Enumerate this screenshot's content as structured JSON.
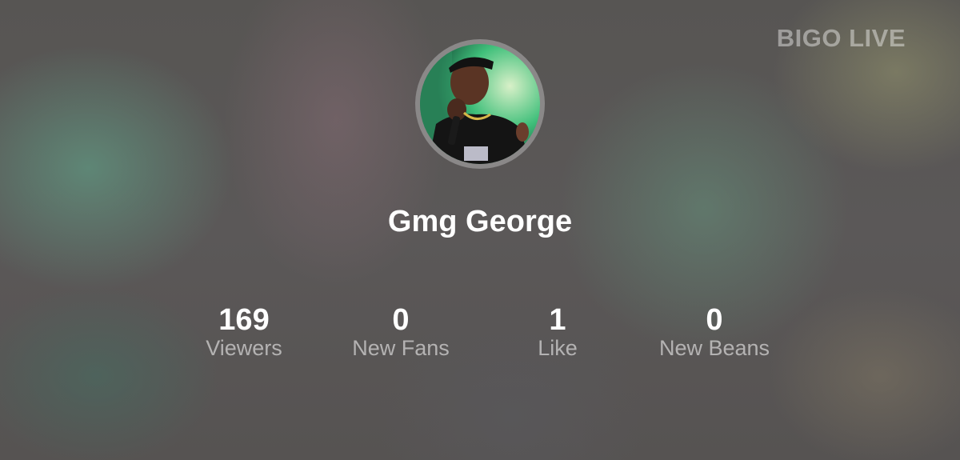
{
  "brand": "BIGO LIVE",
  "profile": {
    "name": "Gmg George"
  },
  "stats": [
    {
      "value": "169",
      "label": "Viewers"
    },
    {
      "value": "0",
      "label": "New Fans"
    },
    {
      "value": "1",
      "label": "Like"
    },
    {
      "value": "0",
      "label": "New Beans"
    }
  ]
}
